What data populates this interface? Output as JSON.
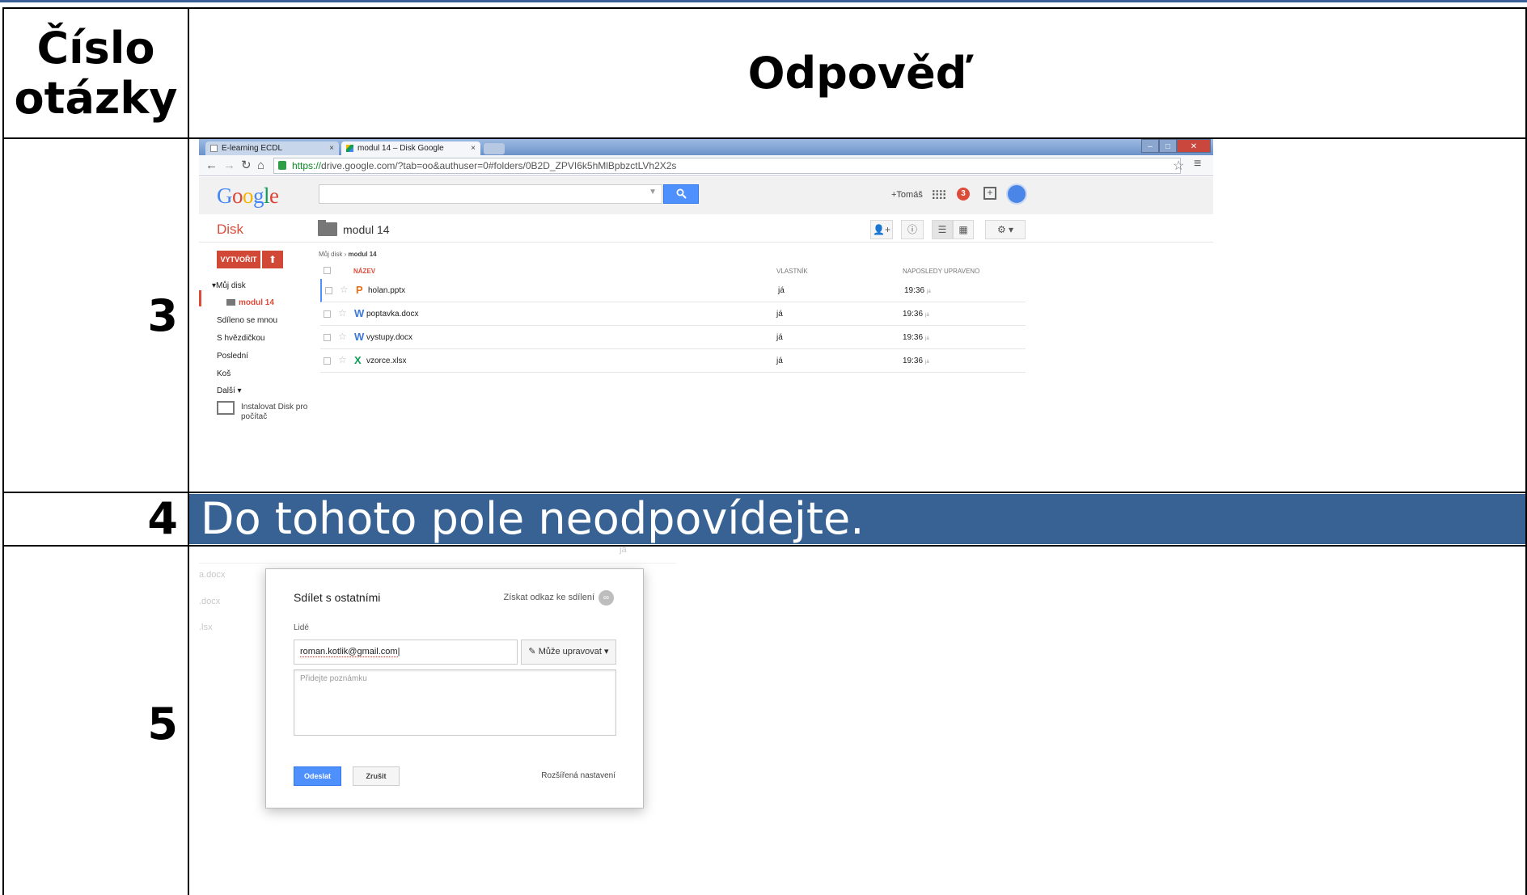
{
  "header": {
    "num_col_title": "Číslo otázky",
    "answer_col_title": "Odpověď"
  },
  "rows": [
    {
      "number": "3"
    },
    {
      "number": "4",
      "text": "Do tohoto pole neodpovídejte."
    },
    {
      "number": "5"
    }
  ],
  "drive": {
    "tabs": [
      {
        "label": "E-learning ECDL",
        "close": "×"
      },
      {
        "label": "modul 14 – Disk Google",
        "close": "×"
      }
    ],
    "url_green": "https://",
    "url_rest": "drive.google.com/?tab=oo&authuser=0#folders/0B2D_ZPVI6k5hMlBpbzctLVh2X2s",
    "logo": "Google",
    "user_label": "+Tomáš",
    "notification_count": "3",
    "app_label": "Disk",
    "folder_title": "modul 14",
    "create_label": "VYTVOŘIT",
    "sidebar": {
      "my_drive": "▾Můj disk",
      "current_folder": "modul 14",
      "items": [
        "Sdíleno se mnou",
        "S hvězdičkou",
        "Poslední",
        "Koš",
        "Další ▾"
      ],
      "install_label": "Instalovat Disk pro počítač"
    },
    "breadcrumb": {
      "root": "Můj disk",
      "sep": "›",
      "current": "modul 14"
    },
    "columns": {
      "name": "NÁZEV",
      "owner": "VLASTNÍK",
      "modified": "NAPOSLEDY UPRAVENO"
    },
    "files": [
      {
        "icon": "P",
        "name": "holan.pptx",
        "owner": "já",
        "modified": "19:36",
        "by": "já",
        "color": "#e8711a"
      },
      {
        "icon": "W",
        "name": "poptavka.docx",
        "owner": "já",
        "modified": "19:36",
        "by": "já",
        "color": "#3c78d8"
      },
      {
        "icon": "W",
        "name": "vystupy.docx",
        "owner": "já",
        "modified": "19:36",
        "by": "já",
        "color": "#3c78d8"
      },
      {
        "icon": "X",
        "name": "vzorce.xlsx",
        "owner": "já",
        "modified": "19:36",
        "by": "já",
        "color": "#0f9d58"
      }
    ]
  },
  "share": {
    "background_files": [
      "a.docx",
      ".docx",
      ".lsx"
    ],
    "background_owner": "já",
    "title": "Sdílet s ostatními",
    "link_label": "Získat odkaz ke sdílení",
    "people_label": "Lidé",
    "email_value": "roman.kotlik@gmail.com",
    "permission": "Může upravovat",
    "note_placeholder": "Přidejte poznámku",
    "send_label": "Odeslat",
    "cancel_label": "Zrušit",
    "advanced_label": "Rozšířená nastavení"
  }
}
